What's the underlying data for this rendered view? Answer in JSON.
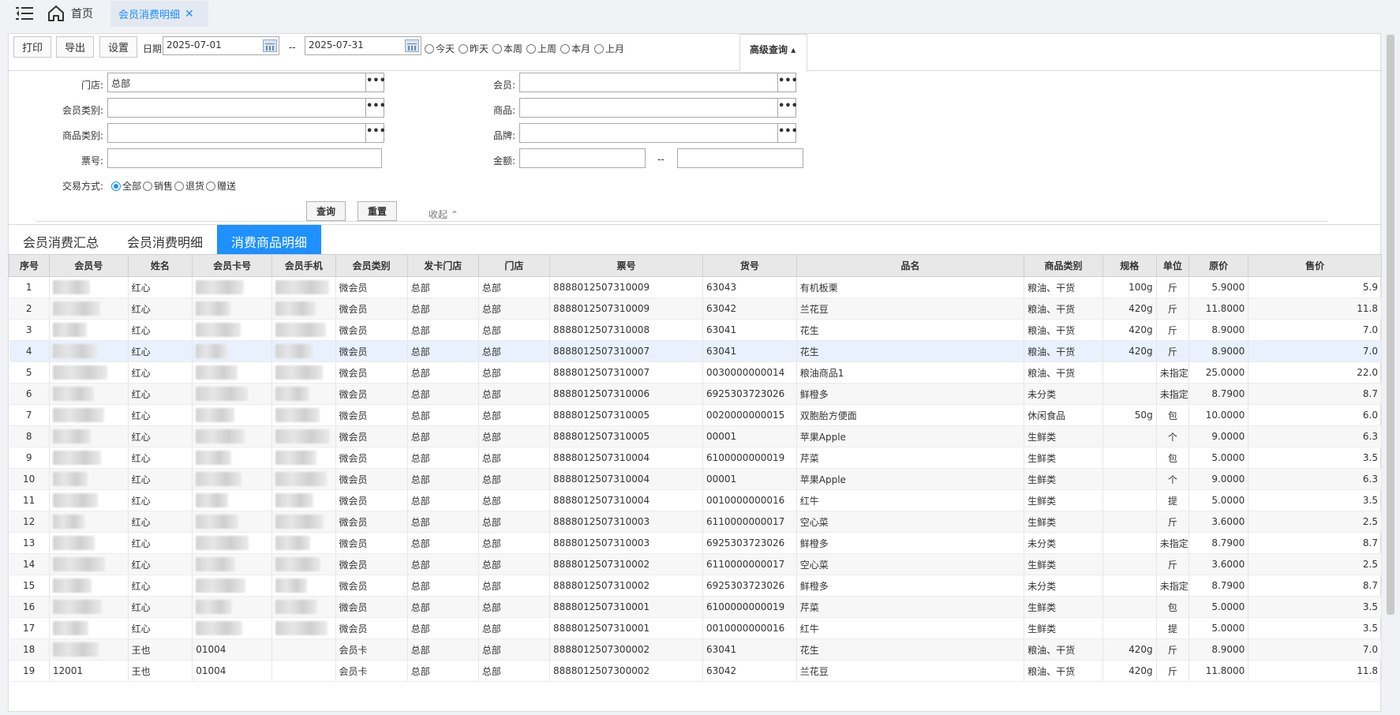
{
  "topbar": {
    "home_label": "首页",
    "active_tab_label": "会员消费明细",
    "close_glyph": "✕"
  },
  "toolbar": {
    "print_label": "打印",
    "export_label": "导出",
    "settings_label": "设置",
    "date_label": "日期",
    "date_from": "2025-07-01",
    "date_sep": "--",
    "date_to": "2025-07-31",
    "quick_ranges": [
      "今天",
      "昨天",
      "本周",
      "上周",
      "本月",
      "上月"
    ],
    "advanced_label": "高级查询"
  },
  "filters": {
    "store_label": "门店:",
    "store_value": "总部",
    "member_type_label": "会员类别:",
    "product_category_label": "商品类别:",
    "ticket_label": "票号:",
    "member_label": "会员:",
    "product_label": "商品:",
    "brand_label": "品牌:",
    "amount_label": "金额:",
    "amount_sep": "--",
    "trade_label": "交易方式:",
    "trade_options": [
      "全部",
      "销售",
      "退货",
      "赠送"
    ],
    "query_label": "查询",
    "reset_label": "重置",
    "collapse_label": "收起"
  },
  "tabs": [
    "会员消费汇总",
    "会员消费明细",
    "消费商品明细"
  ],
  "active_tab_index": 2,
  "table": {
    "columns": [
      "序号",
      "会员号",
      "姓名",
      "会员卡号",
      "会员手机",
      "会员类别",
      "发卡门店",
      "门店",
      "票号",
      "货号",
      "品名",
      "商品类别",
      "规格",
      "单位",
      "原价",
      "售价"
    ],
    "rows": [
      [
        "1",
        "",
        "红心",
        "",
        "",
        "微会员",
        "总部",
        "总部",
        "8888012507310009",
        "63043",
        "有机板栗",
        "粮油、干货",
        "100g",
        "斤",
        "5.9000",
        "5.9"
      ],
      [
        "2",
        "",
        "红心",
        "",
        "",
        "微会员",
        "总部",
        "总部",
        "8888012507310009",
        "63042",
        "兰花豆",
        "粮油、干货",
        "420g",
        "斤",
        "11.8000",
        "11.8"
      ],
      [
        "3",
        "",
        "红心",
        "",
        "",
        "微会员",
        "总部",
        "总部",
        "8888012507310008",
        "63041",
        "花生",
        "粮油、干货",
        "420g",
        "斤",
        "8.9000",
        "7.0"
      ],
      [
        "4",
        "",
        "红心",
        "",
        "",
        "微会员",
        "总部",
        "总部",
        "8888012507310007",
        "63041",
        "花生",
        "粮油、干货",
        "420g",
        "斤",
        "8.9000",
        "7.0"
      ],
      [
        "5",
        "",
        "红心",
        "",
        "",
        "微会员",
        "总部",
        "总部",
        "8888012507310007",
        "0030000000014",
        "粮油商品1",
        "粮油、干货",
        "",
        "未指定",
        "25.0000",
        "22.0"
      ],
      [
        "6",
        "",
        "红心",
        "",
        "",
        "微会员",
        "总部",
        "总部",
        "8888012507310006",
        "6925303723026",
        "鲜橙多",
        "未分类",
        "",
        "未指定",
        "8.7900",
        "8.7"
      ],
      [
        "7",
        "",
        "红心",
        "",
        "",
        "微会员",
        "总部",
        "总部",
        "8888012507310005",
        "0020000000015",
        "双胞胎方便面",
        "休闲食品",
        "50g",
        "包",
        "10.0000",
        "6.0"
      ],
      [
        "8",
        "",
        "红心",
        "",
        "",
        "微会员",
        "总部",
        "总部",
        "8888012507310005",
        "00001",
        "苹果Apple",
        "生鲜类",
        "",
        "个",
        "9.0000",
        "6.3"
      ],
      [
        "9",
        "",
        "红心",
        "",
        "",
        "微会员",
        "总部",
        "总部",
        "8888012507310004",
        "6100000000019",
        "芹菜",
        "生鲜类",
        "",
        "包",
        "5.0000",
        "3.5"
      ],
      [
        "10",
        "",
        "红心",
        "",
        "",
        "微会员",
        "总部",
        "总部",
        "8888012507310004",
        "00001",
        "苹果Apple",
        "生鲜类",
        "",
        "个",
        "9.0000",
        "6.3"
      ],
      [
        "11",
        "",
        "红心",
        "",
        "",
        "微会员",
        "总部",
        "总部",
        "8888012507310004",
        "0010000000016",
        "红牛",
        "生鲜类",
        "",
        "提",
        "5.0000",
        "3.5"
      ],
      [
        "12",
        "",
        "红心",
        "",
        "",
        "微会员",
        "总部",
        "总部",
        "8888012507310003",
        "6110000000017",
        "空心菜",
        "生鲜类",
        "",
        "斤",
        "3.6000",
        "2.5"
      ],
      [
        "13",
        "",
        "红心",
        "",
        "",
        "微会员",
        "总部",
        "总部",
        "8888012507310003",
        "6925303723026",
        "鲜橙多",
        "未分类",
        "",
        "未指定",
        "8.7900",
        "8.7"
      ],
      [
        "14",
        "",
        "红心",
        "",
        "",
        "微会员",
        "总部",
        "总部",
        "8888012507310002",
        "6110000000017",
        "空心菜",
        "生鲜类",
        "",
        "斤",
        "3.6000",
        "2.5"
      ],
      [
        "15",
        "",
        "红心",
        "",
        "",
        "微会员",
        "总部",
        "总部",
        "8888012507310002",
        "6925303723026",
        "鲜橙多",
        "未分类",
        "",
        "未指定",
        "8.7900",
        "8.7"
      ],
      [
        "16",
        "",
        "红心",
        "",
        "",
        "微会员",
        "总部",
        "总部",
        "8888012507310001",
        "6100000000019",
        "芹菜",
        "生鲜类",
        "",
        "包",
        "5.0000",
        "3.5"
      ],
      [
        "17",
        "",
        "红心",
        "",
        "",
        "微会员",
        "总部",
        "总部",
        "8888012507310001",
        "0010000000016",
        "红牛",
        "生鲜类",
        "",
        "提",
        "5.0000",
        "3.5"
      ],
      [
        "18",
        "",
        "王也",
        "01004",
        "",
        "会员卡",
        "总部",
        "总部",
        "8888012507300002",
        "63041",
        "花生",
        "粮油、干货",
        "420g",
        "斤",
        "8.9000",
        "7.0"
      ],
      [
        "19",
        "12001",
        "王也",
        "01004",
        "",
        "会员卡",
        "总部",
        "总部",
        "8888012507300002",
        "63042",
        "兰花豆",
        "粮油、干货",
        "420g",
        "斤",
        "11.8000",
        "11.8"
      ]
    ],
    "highlighted_row_index": 3
  }
}
